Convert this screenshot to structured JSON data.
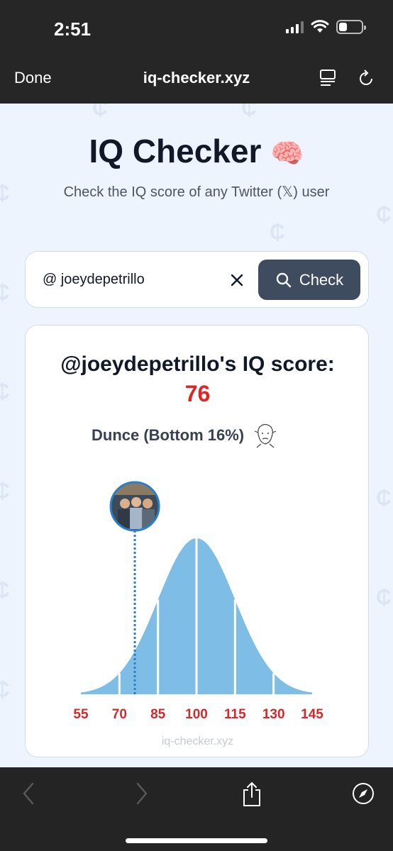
{
  "status_bar": {
    "time": "2:51"
  },
  "browser": {
    "done_label": "Done",
    "url": "iq-checker.xyz"
  },
  "page": {
    "title": "IQ Checker",
    "title_emoji": "🧠",
    "subtitle": "Check the IQ score of any Twitter (𝕏) user",
    "search": {
      "value": "@ joeydepetrillo",
      "button_label": "Check"
    },
    "result": {
      "heading": "@joeydepetrillo's IQ score:",
      "score": "76",
      "category": "Dunce (Bottom 16%)"
    },
    "watermark": "iq-checker.xyz"
  },
  "chart_data": {
    "type": "area",
    "distribution": "normal",
    "mean": 100,
    "std_dev": 15,
    "x_ticks": [
      55,
      70,
      85,
      100,
      115,
      130,
      145
    ],
    "xlim": [
      55,
      145
    ],
    "marker_value": 76,
    "colors": {
      "curve": "#7dbde6",
      "tick_labels": "#d62828",
      "marker": "#2a7fc8"
    }
  }
}
